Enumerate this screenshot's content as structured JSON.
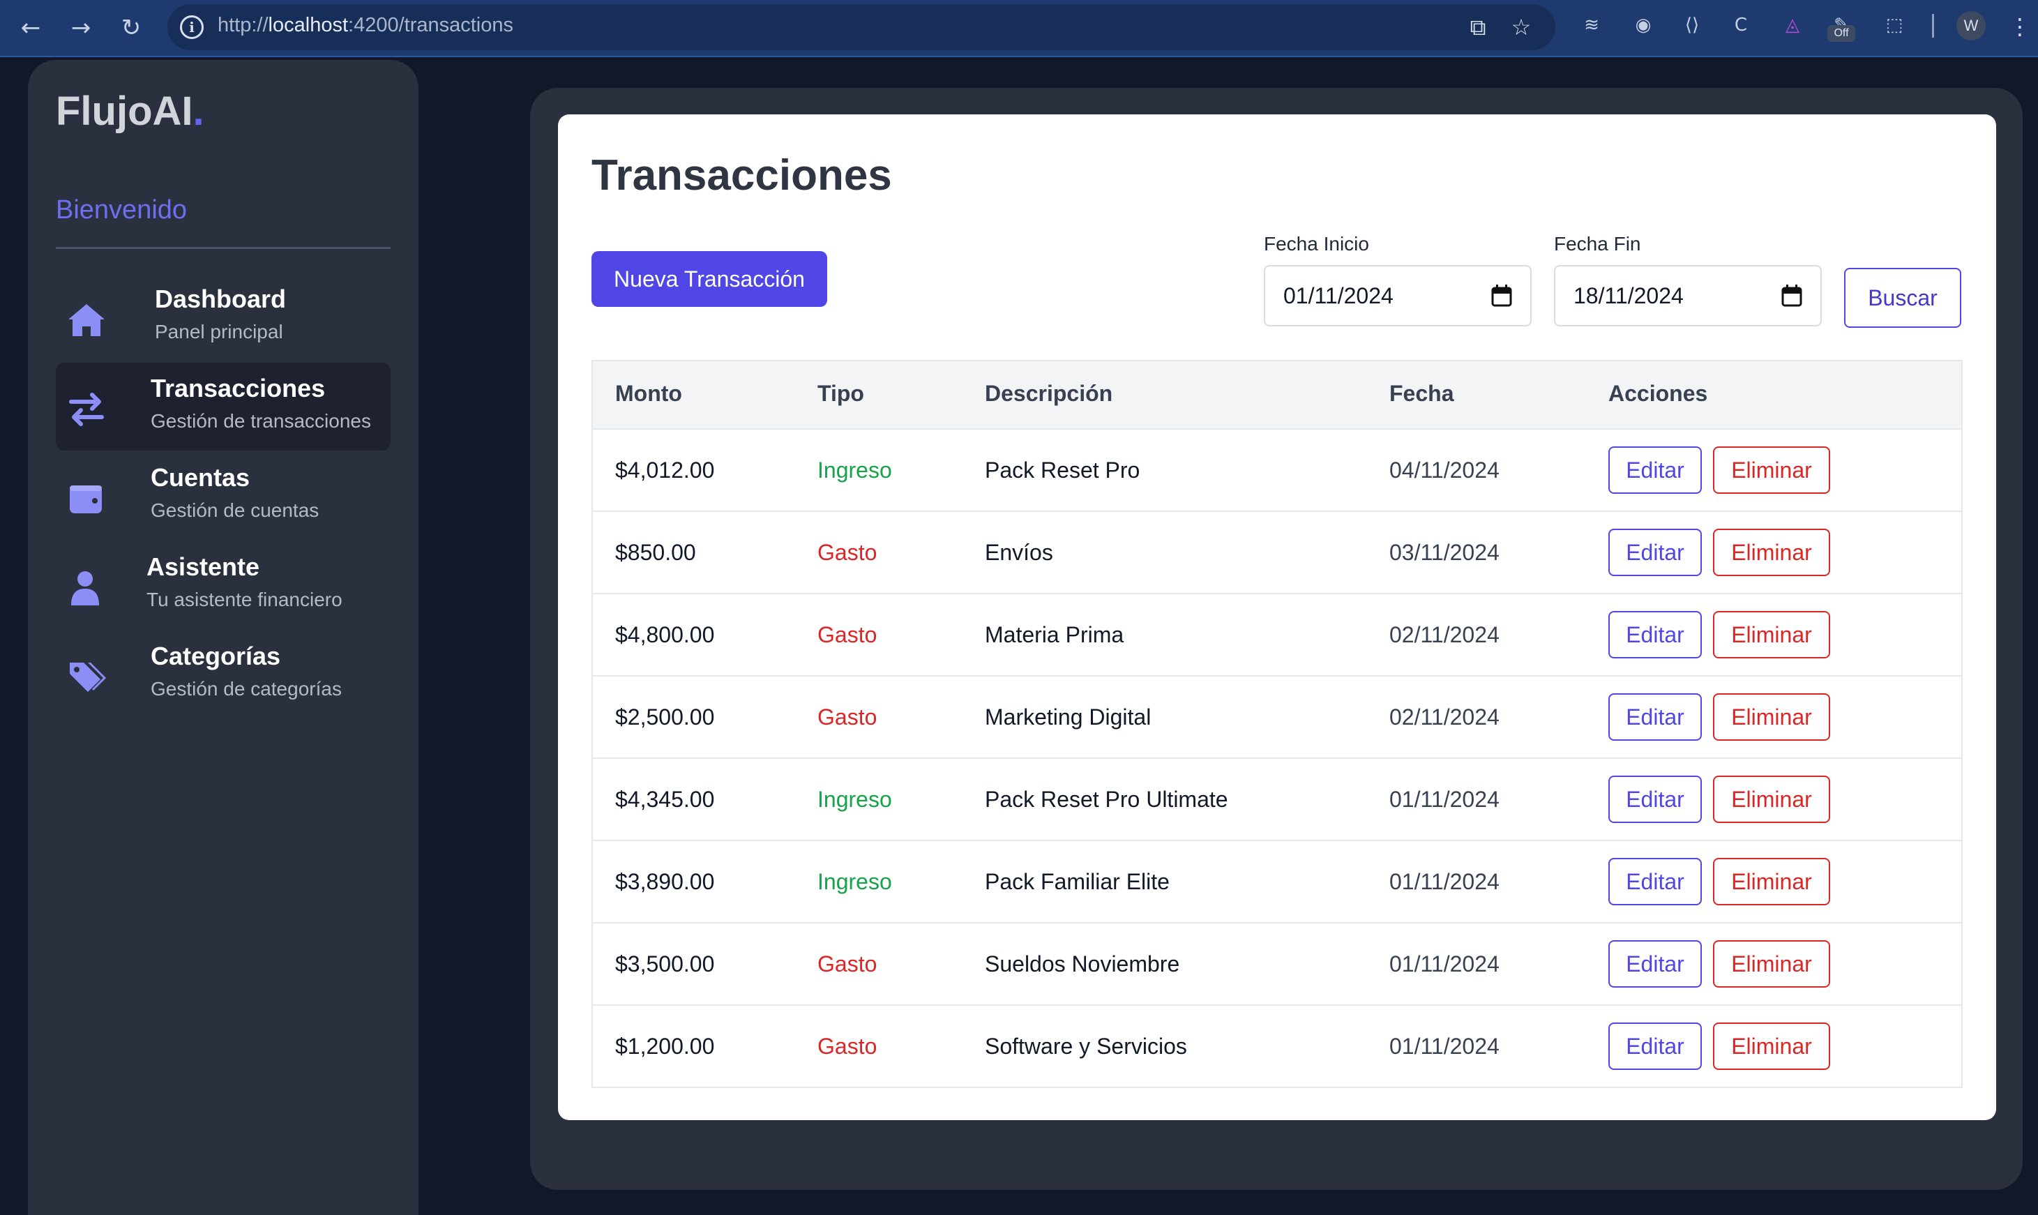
{
  "browser": {
    "url_scheme": "http://",
    "url_host": "localhost",
    "url_path": ":4200/transactions",
    "extension_badge": "Off",
    "profile_initial": "W"
  },
  "sidebar": {
    "logo_text": "FlujoAI",
    "logo_dot": ".",
    "welcome": "Bienvenido",
    "items": [
      {
        "title": "Dashboard",
        "subtitle": "Panel principal",
        "icon": "home-icon",
        "active": false
      },
      {
        "title": "Transacciones",
        "subtitle": "Gestión de transacciones",
        "icon": "swap-arrows-icon",
        "active": true
      },
      {
        "title": "Cuentas",
        "subtitle": "Gestión de cuentas",
        "icon": "wallet-icon",
        "active": false
      },
      {
        "title": "Asistente",
        "subtitle": "Tu asistente financiero",
        "icon": "user-icon",
        "active": false
      },
      {
        "title": "Categorías",
        "subtitle": "Gestión de categorías",
        "icon": "tags-icon",
        "active": false
      }
    ]
  },
  "main": {
    "title": "Transacciones",
    "new_button": "Nueva Transacción",
    "filters": {
      "start_label": "Fecha Inicio",
      "start_value": "01/11/2024",
      "end_label": "Fecha Fin",
      "end_value": "18/11/2024",
      "search_button": "Buscar"
    },
    "table": {
      "headers": [
        "Monto",
        "Tipo",
        "Descripción",
        "Fecha",
        "Acciones"
      ],
      "edit_label": "Editar",
      "delete_label": "Eliminar",
      "rows": [
        {
          "monto": "$4,012.00",
          "tipo": "Ingreso",
          "descripcion": "Pack Reset Pro",
          "fecha": "04/11/2024"
        },
        {
          "monto": "$850.00",
          "tipo": "Gasto",
          "descripcion": "Envíos",
          "fecha": "03/11/2024"
        },
        {
          "monto": "$4,800.00",
          "tipo": "Gasto",
          "descripcion": "Materia Prima",
          "fecha": "02/11/2024"
        },
        {
          "monto": "$2,500.00",
          "tipo": "Gasto",
          "descripcion": "Marketing Digital",
          "fecha": "02/11/2024"
        },
        {
          "monto": "$4,345.00",
          "tipo": "Ingreso",
          "descripcion": "Pack Reset Pro Ultimate",
          "fecha": "01/11/2024"
        },
        {
          "monto": "$3,890.00",
          "tipo": "Ingreso",
          "descripcion": "Pack Familiar Elite",
          "fecha": "01/11/2024"
        },
        {
          "monto": "$3,500.00",
          "tipo": "Gasto",
          "descripcion": "Sueldos Noviembre",
          "fecha": "01/11/2024"
        },
        {
          "monto": "$1,200.00",
          "tipo": "Gasto",
          "descripcion": "Software y Servicios",
          "fecha": "01/11/2024"
        }
      ]
    }
  },
  "colors": {
    "accent": "#4f46e5",
    "income": "#16a34a",
    "expense": "#dc2626",
    "sidebar_bg": "#2b303e",
    "page_bg": "#111827"
  }
}
